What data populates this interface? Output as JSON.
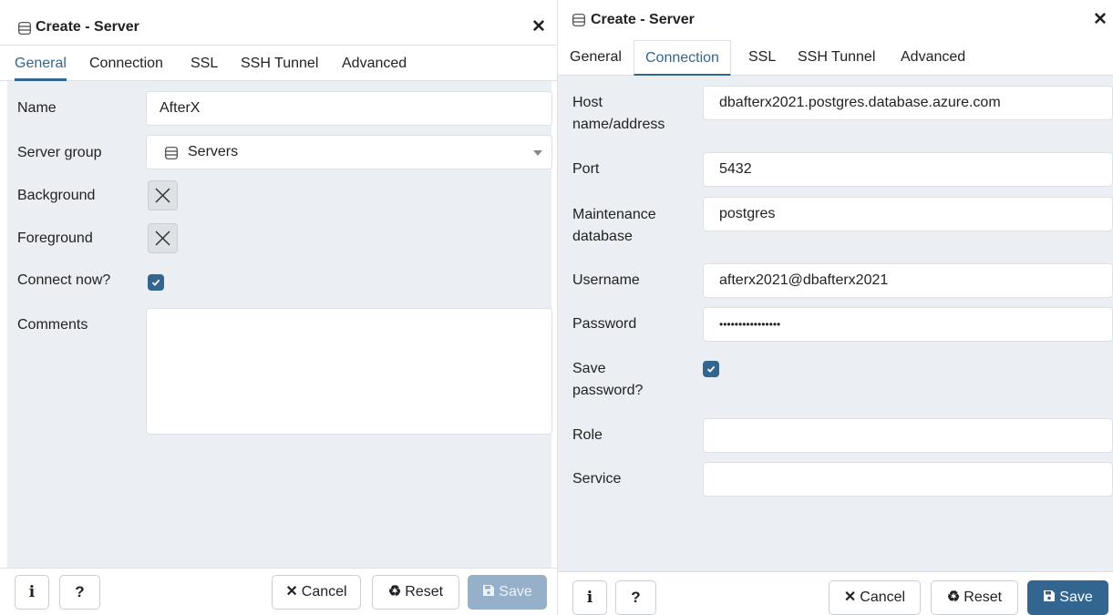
{
  "general_dialog": {
    "title": "Create - Server",
    "tabs": [
      "General",
      "Connection",
      "SSL",
      "SSH Tunnel",
      "Advanced"
    ],
    "active_tab": "General",
    "fields": {
      "name_label": "Name",
      "name_value": "AfterX",
      "server_group_label": "Server group",
      "server_group_value": "Servers",
      "background_label": "Background",
      "foreground_label": "Foreground",
      "connect_now_label": "Connect now?",
      "connect_now_checked": true,
      "comments_label": "Comments",
      "comments_value": ""
    },
    "footer": {
      "info_label": "i",
      "help_label": "?",
      "cancel_label": "Cancel",
      "reset_label": "Reset",
      "save_label": "Save",
      "save_enabled": false
    }
  },
  "connection_dialog": {
    "title": "Create - Server",
    "tabs": [
      "General",
      "Connection",
      "SSL",
      "SSH Tunnel",
      "Advanced"
    ],
    "active_tab": "Connection",
    "fields": {
      "host_label_line1": "Host",
      "host_label_line2": "name/address",
      "host_value": "dbafterx2021.postgres.database.azure.com",
      "port_label": "Port",
      "port_value": "5432",
      "maintenance_db_label_line1": "Maintenance",
      "maintenance_db_label_line2": "database",
      "maintenance_db_value": "postgres",
      "username_label": "Username",
      "username_value": "afterx2021@dbafterx2021",
      "password_label": "Password",
      "password_value": "••••••••••••••••",
      "save_password_label_line1": "Save",
      "save_password_label_line2": "password?",
      "save_password_checked": true,
      "role_label": "Role",
      "role_value": "",
      "service_label": "Service",
      "service_value": ""
    },
    "footer": {
      "info_label": "i",
      "help_label": "?",
      "cancel_label": "Cancel",
      "reset_label": "Reset",
      "save_label": "Save",
      "save_enabled": true
    }
  },
  "icons": {
    "server_icon": "server-icon",
    "close_icon": "close-icon",
    "cancel_icon": "close-icon",
    "reset_icon": "recycle-icon",
    "save_icon": "floppy-disk-icon",
    "check_icon": "check-icon",
    "color_clear_icon": "x-icon"
  },
  "colors": {
    "accent": "#326690",
    "save_disabled": "#97b0c9",
    "content_bg": "#ebeef3",
    "border": "#dde0e6"
  }
}
